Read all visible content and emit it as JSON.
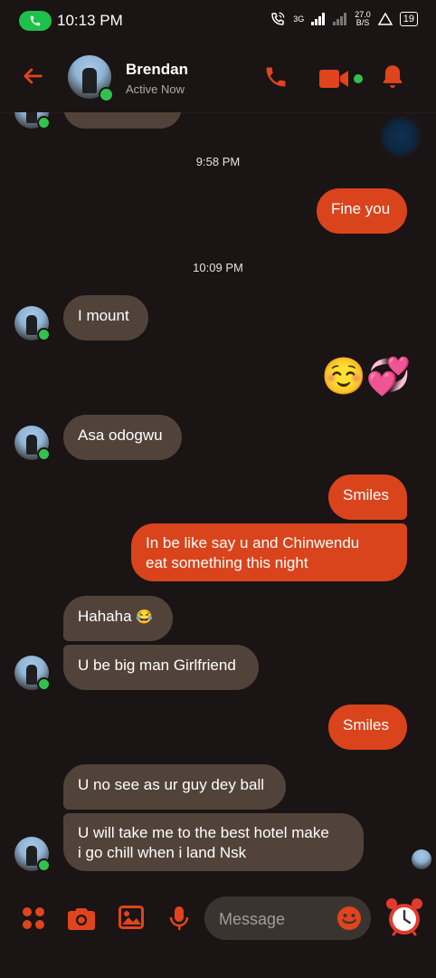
{
  "status_bar": {
    "time": "10:13 PM",
    "network": "3G",
    "speed_value": "27.0",
    "speed_unit": "B/S",
    "battery": "19"
  },
  "header": {
    "contact_name": "Brendan",
    "contact_status": "Active Now"
  },
  "messages": {
    "ts1": "9:58 PM",
    "m_fine_you": "Fine you",
    "ts2": "10:09 PM",
    "m_i_mount": "I mount",
    "m_emoji": "☺️💞",
    "m_asa": "Asa odogwu",
    "m_smiles1": "Smiles",
    "m_inbe_1": "In be like say u and Chinwendu",
    "m_inbe_2": "eat something this night",
    "m_hahaha": "Hahaha",
    "m_hahaha_emoji": "😂",
    "m_bigman": "U be big man Girlfriend",
    "m_smiles2": "Smiles",
    "m_uno": "U no see as ur guy dey ball",
    "m_hotel_1": "U will take me to the best hotel make",
    "m_hotel_2": "i go chill when i land Nsk"
  },
  "composer": {
    "placeholder": "Message"
  },
  "colors": {
    "accent": "#d9441c",
    "incoming_bubble": "#52433a",
    "background": "#1a1414",
    "online": "#31c24d"
  },
  "icons": [
    "phone-icon",
    "back-arrow-icon",
    "call-icon",
    "video-call-icon",
    "bell-icon",
    "apps-icon",
    "camera-icon",
    "gallery-icon",
    "mic-icon",
    "emoji-icon",
    "alarm-clock-icon"
  ]
}
